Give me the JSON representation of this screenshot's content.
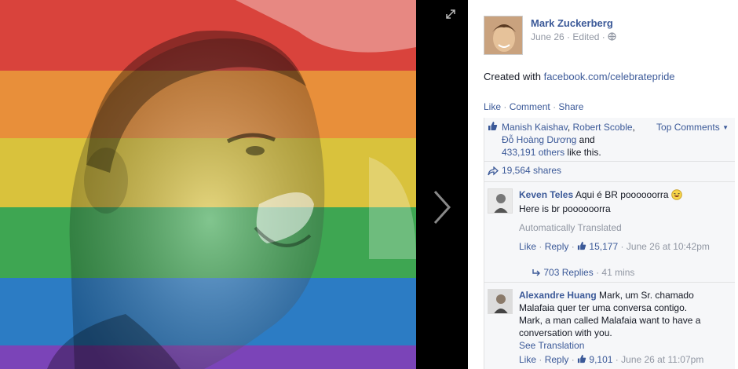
{
  "post": {
    "author_name": "Mark Zuckerberg",
    "date": "June 26",
    "edited": "Edited",
    "text_prefix": "Created with ",
    "text_link": "facebook.com/celebratepride"
  },
  "actions": {
    "like": "Like",
    "comment": "Comment",
    "share": "Share",
    "sep": "·"
  },
  "likes": {
    "name1": "Manish Kaishav",
    "name2": "Robert Scoble",
    "name3": "Đỗ Hoàng Dương",
    "and": "and",
    "others_count": "433,191 others",
    "suffix": "like this.",
    "top_comments": "Top Comments"
  },
  "shares": {
    "label": "19,564 shares"
  },
  "comments": [
    {
      "name": "Keven Teles",
      "text": "Aqui é BR poooooorra",
      "translation": "Here is br poooooorra",
      "auto_translated": "Automatically Translated",
      "like": "Like",
      "reply": "Reply",
      "like_count": "15,177",
      "date": "June 26 at 10:42pm",
      "replies": "703 Replies",
      "replies_time": "41 mins"
    },
    {
      "name": "Alexandre Huang",
      "text_1": "Mark, um Sr. chamado",
      "text_2": "Malafaia quer ter uma conversa contigo.",
      "text_3": "Mark, a man called Malafaia want to have a",
      "text_4": "conversation with you.",
      "see_translation": "See Translation",
      "like": "Like",
      "reply": "Reply",
      "like_count": "9,101",
      "date": "June 26 at 11:07pm"
    }
  ],
  "colors": {
    "facebook_blue": "#3b5998",
    "pride_red": "#e8322c",
    "pride_orange": "#f39d2a",
    "pride_yellow": "#f2d63a",
    "pride_green": "#3fb24a",
    "pride_blue": "#2a7fd4",
    "pride_purple": "#7a3ec0"
  },
  "icons": {
    "expand": "expand-icon",
    "next": "chevron-right-icon",
    "globe": "globe-icon",
    "like": "thumbs-up-icon",
    "share": "share-arrow-icon",
    "reply": "reply-arrow-icon",
    "emoji": "laughing-emoji-icon"
  }
}
